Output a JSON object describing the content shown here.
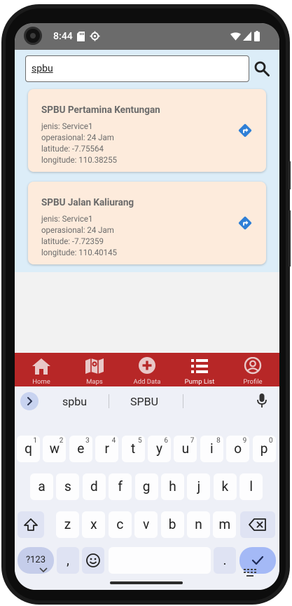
{
  "status_bar": {
    "time": "8:44"
  },
  "search": {
    "value": "spbu"
  },
  "stations": [
    {
      "name": "SPBU Pertamina Kentungan",
      "type": "jenis: Service1",
      "hours": "operasional: 24 Jam",
      "latitude": "latitude: -7.75564",
      "longitude": "longitude: 110.38255"
    },
    {
      "name": "SPBU Jalan Kaliurang",
      "type": "jenis: Service1",
      "hours": "operasional: 24 Jam",
      "latitude": "latitude: -7.72359",
      "longitude": "longitude: 110.40145"
    }
  ],
  "bottom_nav": {
    "items": [
      {
        "label": "Home",
        "icon": "home-icon"
      },
      {
        "label": "Maps",
        "icon": "map-icon"
      },
      {
        "label": "Add Data",
        "icon": "add-circle-icon"
      },
      {
        "label": "Pump List",
        "icon": "list-icon"
      },
      {
        "label": "Profile",
        "icon": "account-circle-icon"
      }
    ],
    "active": "Pump List"
  },
  "keyboard": {
    "suggestions": [
      "spbu",
      "SPBU"
    ],
    "row1": [
      "q",
      "w",
      "e",
      "r",
      "t",
      "y",
      "u",
      "i",
      "o",
      "p"
    ],
    "row1_hints": [
      "1",
      "2",
      "3",
      "4",
      "5",
      "6",
      "7",
      "8",
      "9",
      "0"
    ],
    "row2": [
      "a",
      "s",
      "d",
      "f",
      "g",
      "h",
      "j",
      "k",
      "l"
    ],
    "row3": [
      "z",
      "x",
      "c",
      "v",
      "b",
      "n",
      "m"
    ],
    "symbols_label": "?123",
    "comma": ",",
    "period": "."
  },
  "colors": {
    "nav_bg": "#b72727",
    "card_bg": "#fdebdc",
    "content_bg": "#dcedf8",
    "accent_blue": "#2f7fd6"
  }
}
